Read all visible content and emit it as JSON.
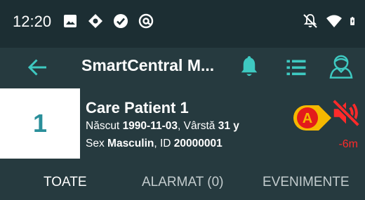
{
  "status_bar": {
    "time": "12:20",
    "icons_left": [
      "image-icon",
      "settings-notification-icon",
      "check-circle-icon",
      "at-sign-icon"
    ],
    "icons_right": [
      "notifications-off-icon",
      "wifi-icon",
      "battery-charging-icon"
    ]
  },
  "app_bar": {
    "title": "SmartCentral M...",
    "accent_color": "#3ec9c1"
  },
  "patient": {
    "bed": "1",
    "name": "Care Patient 1",
    "born_label": "Născut",
    "born_value": "1990-11-03",
    "age_label": ", Vârstă",
    "age_value": "31 y",
    "sex_label": "Sex",
    "sex_value": "Masculin",
    "id_label": ", ID",
    "id_value": "20000001"
  },
  "alarm": {
    "marker": "A",
    "marker_color": "#f5b800",
    "muted_time": "-6m",
    "muted_color": "#ff2a2a"
  },
  "tabs": [
    {
      "label": "TOATE",
      "active": true
    },
    {
      "label": "ALARMAT (0)",
      "active": false
    },
    {
      "label": "EVENIMENTE",
      "active": false
    }
  ]
}
